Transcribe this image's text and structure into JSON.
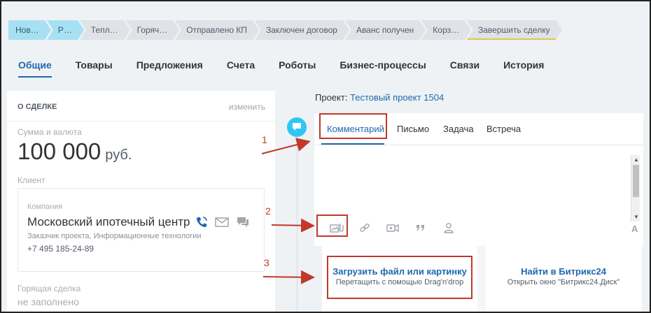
{
  "stages": [
    "Нов…",
    "Р…",
    "Тепл…",
    "Горяч…",
    "Отправлено КП",
    "Заключен договор",
    "Аванс получен",
    "Корз…",
    "Завершить сделку"
  ],
  "tabs": [
    "Общие",
    "Товары",
    "Предложения",
    "Счета",
    "Роботы",
    "Бизнес-процессы",
    "Связи",
    "История"
  ],
  "deal": {
    "header": "О СДЕЛКЕ",
    "edit": "изменить",
    "sum_label": "Сумма и валюта",
    "amount": "100 000",
    "currency": "руб.",
    "client_label": "Клиент",
    "company_label": "Компания",
    "company_name": "Московский ипотечный центр",
    "company_desc": "Заказчик проекта, Информационные технологии",
    "phone": "+7 495 185-24-89",
    "hot_label": "Горящая сделка",
    "hot_value": "не заполнено"
  },
  "project": {
    "label": "Проект:",
    "name": "Тестовый проект 1504"
  },
  "editor": {
    "tabs": [
      "Комментарий",
      "Письмо",
      "Задача",
      "Встреча"
    ],
    "font_button": "A"
  },
  "upload": {
    "title": "Загрузить файл или картинку",
    "subtitle": "Перетащить с помощью Drag'n'drop",
    "b24_title": "Найти в Битрикс24",
    "b24_subtitle": "Открыть окно \"Битрикс24.Диск\""
  },
  "annotations": [
    "1",
    "2",
    "3"
  ],
  "colors": {
    "accent": "#2067b0",
    "annotation": "#c0392b",
    "stage_active": "#a7e0f3"
  }
}
